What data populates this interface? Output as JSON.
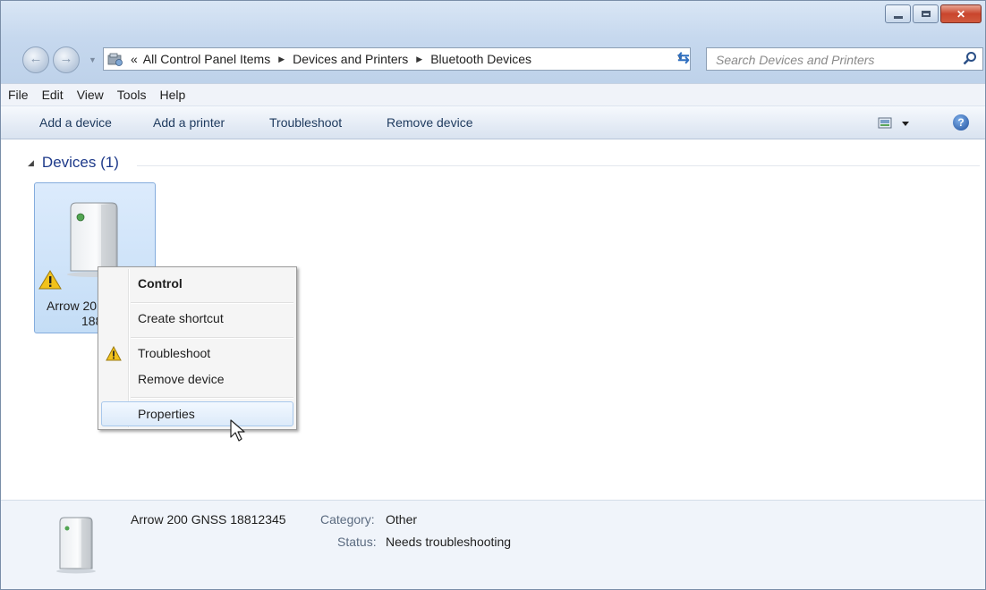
{
  "window": {
    "caption_buttons": [
      "minimize",
      "maximize",
      "close"
    ]
  },
  "address_bar": {
    "chevron": "«",
    "breadcrumbs": [
      "All Control Panel Items",
      "Devices and Printers",
      "Bluetooth Devices"
    ]
  },
  "search": {
    "placeholder": "Search Devices and Printers"
  },
  "menubar": [
    "File",
    "Edit",
    "View",
    "Tools",
    "Help"
  ],
  "commandbar": {
    "add_device": "Add a device",
    "add_printer": "Add a printer",
    "troubleshoot": "Troubleshoot",
    "remove_device": "Remove device",
    "help_glyph": "?"
  },
  "group": {
    "label": "Devices (1)"
  },
  "device": {
    "label_line1": "Arrow 20",
    "label_line2": "1881"
  },
  "context_menu": {
    "control": "Control",
    "create_shortcut": "Create shortcut",
    "troubleshoot": "Troubleshoot",
    "remove_device": "Remove device",
    "properties": "Properties"
  },
  "details": {
    "name": "Arrow 200 GNSS 18812345",
    "category_key": "Category:",
    "category_value": "Other",
    "status_key": "Status:",
    "status_value": "Needs troubleshooting"
  },
  "colors": {
    "accent_blue": "#1e3a8a",
    "selection": "#cfe3fa",
    "warning": "#f2c21b"
  }
}
